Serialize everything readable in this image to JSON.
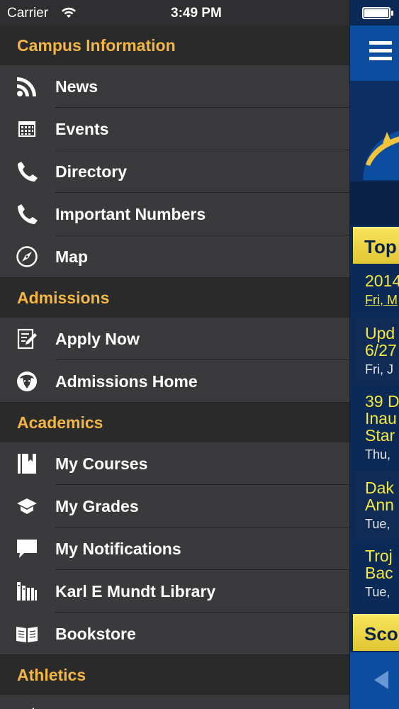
{
  "status_bar": {
    "carrier": "Carrier",
    "time": "3:49 PM"
  },
  "menu": {
    "sections": [
      {
        "title": "Campus Information",
        "items": [
          {
            "label": "News",
            "icon": "rss-icon"
          },
          {
            "label": "Events",
            "icon": "calendar-icon"
          },
          {
            "label": "Directory",
            "icon": "phone-icon"
          },
          {
            "label": "Important Numbers",
            "icon": "phone-icon"
          },
          {
            "label": "Map",
            "icon": "compass-icon"
          }
        ]
      },
      {
        "title": "Admissions",
        "items": [
          {
            "label": "Apply Now",
            "icon": "edit-form-icon"
          },
          {
            "label": "Admissions Home",
            "icon": "mascot-icon"
          }
        ]
      },
      {
        "title": "Academics",
        "items": [
          {
            "label": "My Courses",
            "icon": "book-icon"
          },
          {
            "label": "My Grades",
            "icon": "graduation-cap-icon"
          },
          {
            "label": "My Notifications",
            "icon": "speech-bubble-icon"
          },
          {
            "label": "Karl E Mundt Library",
            "icon": "library-books-icon"
          },
          {
            "label": "Bookstore",
            "icon": "open-book-icon"
          }
        ]
      },
      {
        "title": "Athletics",
        "items": []
      }
    ]
  },
  "peek_panel": {
    "top_header": "Top",
    "news": [
      {
        "title_lines": [
          "2014"
        ],
        "date": "Fri, M"
      },
      {
        "title_lines": [
          "Upd",
          "6/27"
        ],
        "date": "Fri, J"
      },
      {
        "title_lines": [
          "39 D",
          "Inau",
          "Star"
        ],
        "date": "Thu,"
      },
      {
        "title_lines": [
          "Dak",
          "Ann"
        ],
        "date": "Tue,"
      },
      {
        "title_lines": [
          "Troj",
          "Bac"
        ],
        "date": "Tue,"
      }
    ],
    "bottom_header": "Scor"
  }
}
